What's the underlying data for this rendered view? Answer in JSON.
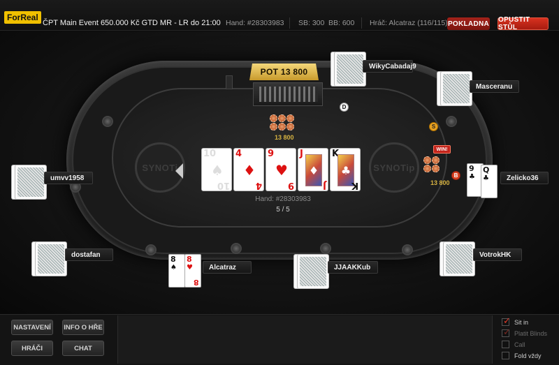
{
  "topbar": {
    "brand": "ForReal",
    "event": "ČPT Main Event 650.000 Kč GTD MR - LR do 21:00",
    "hand": "Hand: #28303983",
    "sb": "SB: 300",
    "bb": "BB: 600",
    "player": "Hráč: Alcatraz (116/115)",
    "cashier_label": "POKLADNA",
    "leave_label": "OPUSTIT STŮL"
  },
  "table": {
    "pot_label": "POT 13 800",
    "center_chips_amount": "13 800",
    "winner_chips_amount": "13 800",
    "win_badge": "WIN!",
    "logo_left": "SYNOTi",
    "logo_right": "SYNOTip",
    "hand_info": "Hand: #28303983",
    "cards_count": "5 / 5",
    "dealer_marker": "D",
    "small_blind_marker": "S",
    "big_blind_marker": "B"
  },
  "board": [
    {
      "rank": "10",
      "suit": "♠",
      "color": "black",
      "face": false
    },
    {
      "rank": "4",
      "suit": "♦",
      "color": "red",
      "face": false
    },
    {
      "rank": "9",
      "suit": "♥",
      "color": "red",
      "face": false
    },
    {
      "rank": "J",
      "suit": "♦",
      "color": "red",
      "face": true
    },
    {
      "rank": "K",
      "suit": "♣",
      "color": "black",
      "face": true
    }
  ],
  "players": {
    "wiky": "WikyCabadaj9",
    "masceranu": "Masceranu",
    "umvv": "umvv1958",
    "zelicko": "Zelicko36",
    "dostafan": "dostafan",
    "alcatraz": "Alcatraz",
    "jjaakkub": "JJAAKKub",
    "votrok": "VotrokHK"
  },
  "zelicko_cards": [
    {
      "rank": "9",
      "suit": "♣",
      "color": "black"
    },
    {
      "rank": "Q",
      "suit": "♣",
      "color": "black"
    }
  ],
  "alcatraz_cards": [
    {
      "rank": "8",
      "suit": "♠",
      "color": "black"
    },
    {
      "rank": "8",
      "suit": "♥",
      "color": "red"
    }
  ],
  "bottom": {
    "settings_label": "NASTAVENÍ",
    "info_label": "INFO O HŘE",
    "players_label": "HRÁČI",
    "chat_label": "CHAT",
    "options": [
      {
        "label": "Sit in",
        "checked": true,
        "enabled": true
      },
      {
        "label": "Platit Blinds",
        "checked": true,
        "enabled": false
      },
      {
        "label": "Call",
        "checked": false,
        "enabled": false
      },
      {
        "label": "Fold vždy",
        "checked": false,
        "enabled": true
      }
    ]
  },
  "colors": {
    "accent_gold": "#d7b341",
    "danger_red": "#c2241c",
    "felt": "#1e1e1e"
  }
}
